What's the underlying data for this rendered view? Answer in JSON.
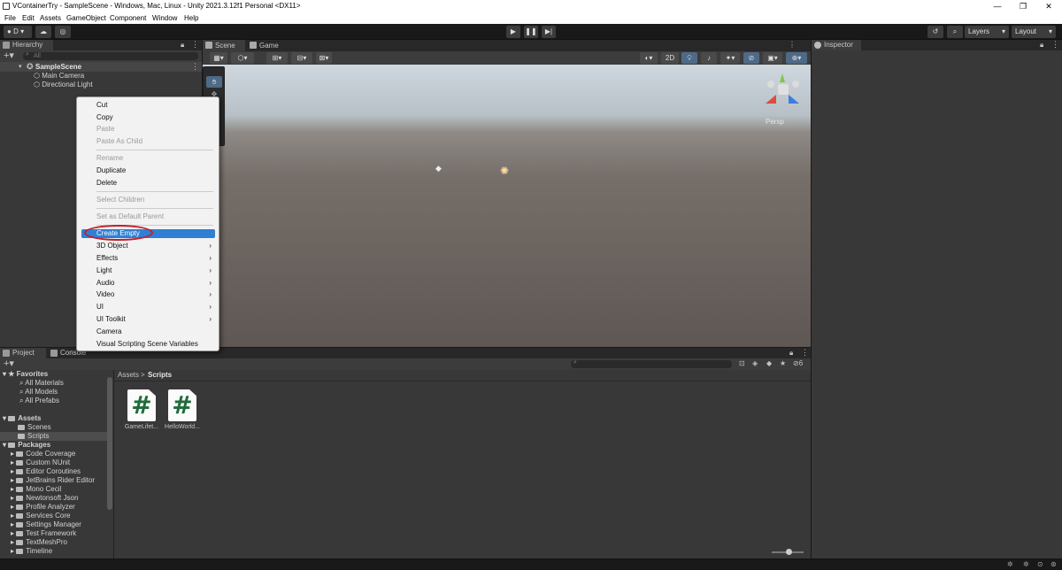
{
  "window": {
    "title": "VContainerTry - SampleScene - Windows, Mac, Linux - Unity 2021.3.12f1 Personal <DX11>",
    "minimize": "—",
    "maximize": "❐",
    "close": "✕"
  },
  "menubar": [
    "File",
    "Edit",
    "Assets",
    "GameObject",
    "Component",
    "Window",
    "Help"
  ],
  "toolbar": {
    "account": "D",
    "layers_label": "Layers",
    "layout_label": "Layout"
  },
  "hierarchy": {
    "tab": "Hierarchy",
    "search_placeholder": "All",
    "scene": "SampleScene",
    "items": [
      "Main Camera",
      "Directional Light"
    ]
  },
  "scene_tabs": [
    "Scene",
    "Game"
  ],
  "scene": {
    "view_2d": "2D",
    "persp": "Persp"
  },
  "context_menu": {
    "items": [
      {
        "label": "Cut",
        "disabled": false
      },
      {
        "label": "Copy",
        "disabled": false
      },
      {
        "label": "Paste",
        "disabled": true
      },
      {
        "label": "Paste As Child",
        "disabled": true
      },
      {
        "label": "Rename",
        "disabled": true
      },
      {
        "label": "Duplicate",
        "disabled": false
      },
      {
        "label": "Delete",
        "disabled": false
      },
      {
        "label": "Select Children",
        "disabled": true
      },
      {
        "label": "Set as Default Parent",
        "disabled": true
      },
      {
        "label": "Create Empty",
        "highlighted": true
      },
      {
        "label": "3D Object",
        "submenu": true
      },
      {
        "label": "Effects",
        "submenu": true
      },
      {
        "label": "Light",
        "submenu": true
      },
      {
        "label": "Audio",
        "submenu": true
      },
      {
        "label": "Video",
        "submenu": true
      },
      {
        "label": "UI",
        "submenu": true
      },
      {
        "label": "UI Toolkit",
        "submenu": true
      },
      {
        "label": "Camera",
        "submenu": false
      },
      {
        "label": "Visual Scripting Scene Variables",
        "submenu": false
      }
    ]
  },
  "project": {
    "tabs": [
      "Project",
      "Console"
    ],
    "favorites_label": "Favorites",
    "favorites": [
      "All Materials",
      "All Models",
      "All Prefabs"
    ],
    "assets_label": "Assets",
    "assets": [
      "Scenes",
      "Scripts"
    ],
    "packages_label": "Packages",
    "packages": [
      "Code Coverage",
      "Custom NUnit",
      "Editor Coroutines",
      "JetBrains Rider Editor",
      "Mono Cecil",
      "Newtonsoft Json",
      "Profile Analyzer",
      "Services Core",
      "Settings Manager",
      "Test Framework",
      "TextMeshPro",
      "Timeline"
    ],
    "breadcrumb_root": "Assets",
    "breadcrumb_sep": ">",
    "breadcrumb_current": "Scripts",
    "files": [
      "GameLifet...",
      "HelloWorld..."
    ],
    "hidden_count": "6"
  },
  "inspector": {
    "tab": "Inspector"
  }
}
